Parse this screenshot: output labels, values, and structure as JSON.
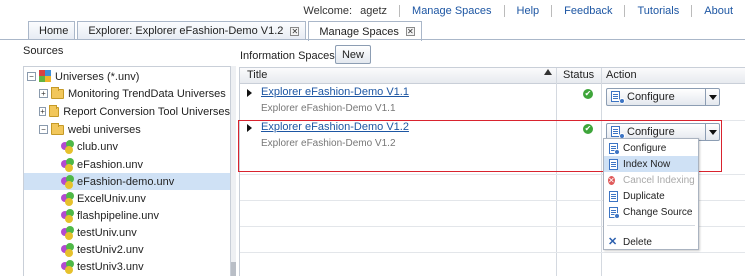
{
  "topnav": {
    "welcome": "Welcome:",
    "user": "agetz",
    "links": [
      "Manage Spaces",
      "Help",
      "Feedback",
      "Tutorials",
      "About"
    ]
  },
  "tabs": [
    {
      "label": "Home"
    },
    {
      "label": "Explorer: Explorer eFashion-Demo V1.2"
    },
    {
      "label": "Manage Spaces"
    }
  ],
  "sources": {
    "title": "Sources",
    "tree": [
      {
        "label": "Universes (*.unv)",
        "expander": "−",
        "icon": "universes-icon"
      },
      {
        "label": "Monitoring TrendData Universes",
        "expander": "+",
        "icon": "folder-icon"
      },
      {
        "label": "Report Conversion Tool Universes",
        "expander": "+",
        "icon": "folder-icon"
      },
      {
        "label": "webi universes",
        "expander": "−",
        "icon": "folder-open-icon"
      },
      {
        "label": "club.unv",
        "icon": "universe-icon"
      },
      {
        "label": "eFashion.unv",
        "icon": "universe-icon"
      },
      {
        "label": "eFashion-demo.unv",
        "icon": "universe-icon",
        "selected": true
      },
      {
        "label": "ExcelUniv.unv",
        "icon": "universe-icon"
      },
      {
        "label": "flashpipeline.unv",
        "icon": "universe-icon"
      },
      {
        "label": "testUniv.unv",
        "icon": "universe-icon"
      },
      {
        "label": "testUniv2.unv",
        "icon": "universe-icon"
      },
      {
        "label": "testUniv3.unv",
        "icon": "universe-icon"
      }
    ]
  },
  "info_spaces": {
    "title": "Information Spaces",
    "new_label": "New",
    "columns": {
      "title": "Title",
      "status": "Status",
      "action": "Action"
    },
    "rows": [
      {
        "name": "Explorer eFashion-Demo V1.1",
        "subtitle": "Explorer eFashion-Demo V1.1",
        "action": "Configure"
      },
      {
        "name": "Explorer eFashion-Demo V1.2",
        "subtitle": "Explorer eFashion-Demo V1.2",
        "action": "Configure"
      }
    ]
  },
  "action_menu": {
    "items": [
      {
        "label": "Configure"
      },
      {
        "label": "Index Now",
        "highlighted": true
      },
      {
        "label": "Cancel Indexing",
        "disabled": true
      },
      {
        "label": "Duplicate"
      },
      {
        "label": "Change Source"
      },
      {
        "label": "Delete"
      }
    ]
  },
  "colors": {
    "link": "#1d56a3",
    "highlight_border": "#d9232e",
    "selection": "#cfe1f5"
  }
}
